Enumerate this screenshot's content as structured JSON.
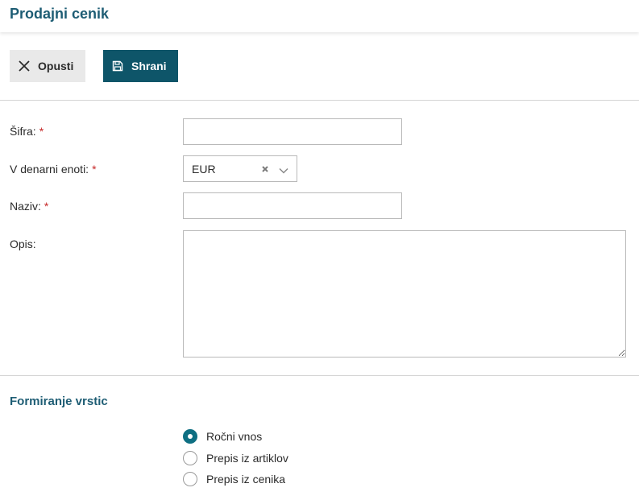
{
  "header": {
    "title": "Prodajni cenik"
  },
  "toolbar": {
    "cancel_label": "Opusti",
    "cancel_icon": "close-icon",
    "save_label": "Shrani",
    "save_icon": "floppy-disk-icon"
  },
  "form": {
    "sifra": {
      "label": "Šifra:",
      "required_mark": "*",
      "value": ""
    },
    "currency": {
      "label": "V denarni enoti:",
      "required_mark": "*",
      "selected": "EUR"
    },
    "naziv": {
      "label": "Naziv:",
      "required_mark": "*",
      "value": ""
    },
    "opis": {
      "label": "Opis:",
      "value": ""
    }
  },
  "rows_section": {
    "title": "Formiranje vrstic",
    "options": [
      {
        "label": "Ročni vnos",
        "checked": true
      },
      {
        "label": "Prepis iz artiklov",
        "checked": false
      },
      {
        "label": "Prepis iz cenika",
        "checked": false
      }
    ]
  },
  "colors": {
    "accent": "#1e5d74",
    "primary_button": "#0e5569",
    "required": "#c62828",
    "radio_checked": "#0e6f82"
  }
}
